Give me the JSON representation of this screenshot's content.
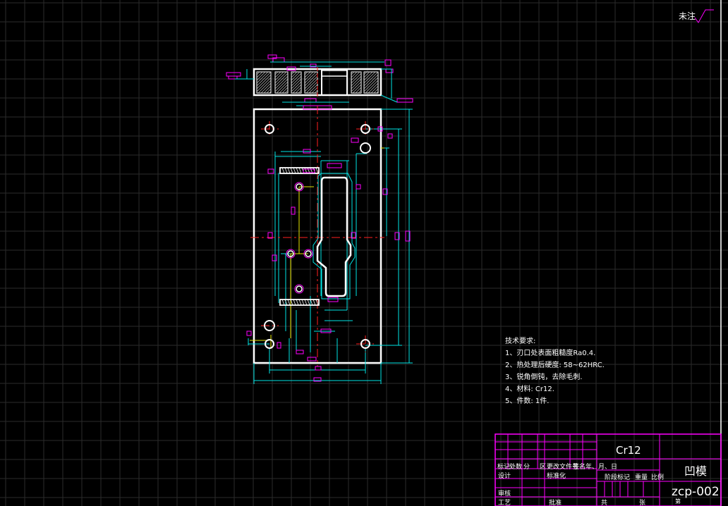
{
  "roughness_note": "未注",
  "tech_requirements": {
    "title": "技术要求:",
    "items": [
      "1、刃口处表面粗糙度Ra0.4.",
      "2、热处理后硬度: 58~62HRC.",
      "3、锐角倒钝，去除毛刺.",
      "4、材料: Cr12.",
      "5、件数: 1件."
    ]
  },
  "title_block": {
    "material": "Cr12",
    "part_name": "凹模",
    "drawing_no": "zcp-002",
    "revision_row": [
      "标记",
      "处数",
      "分",
      "区",
      "更改文件号",
      "签名",
      "年、月、日"
    ],
    "design": "设计",
    "standardize": "标准化",
    "stage_marks": "阶段标记",
    "weight": "重量",
    "scale": "比例",
    "review": "审核",
    "process": "工艺",
    "approve": "批准",
    "total": "共",
    "sheet": "张",
    "sheet_no": "第"
  },
  "colors": {
    "background": "#000000",
    "grid": "#2b2b2b",
    "outline": "#ffffff",
    "dimension": "#00e5e5",
    "annotation": "#ff00ff",
    "hidden": "#e5e500",
    "center": "#ff2020",
    "titleblock": "#ff00ff"
  }
}
